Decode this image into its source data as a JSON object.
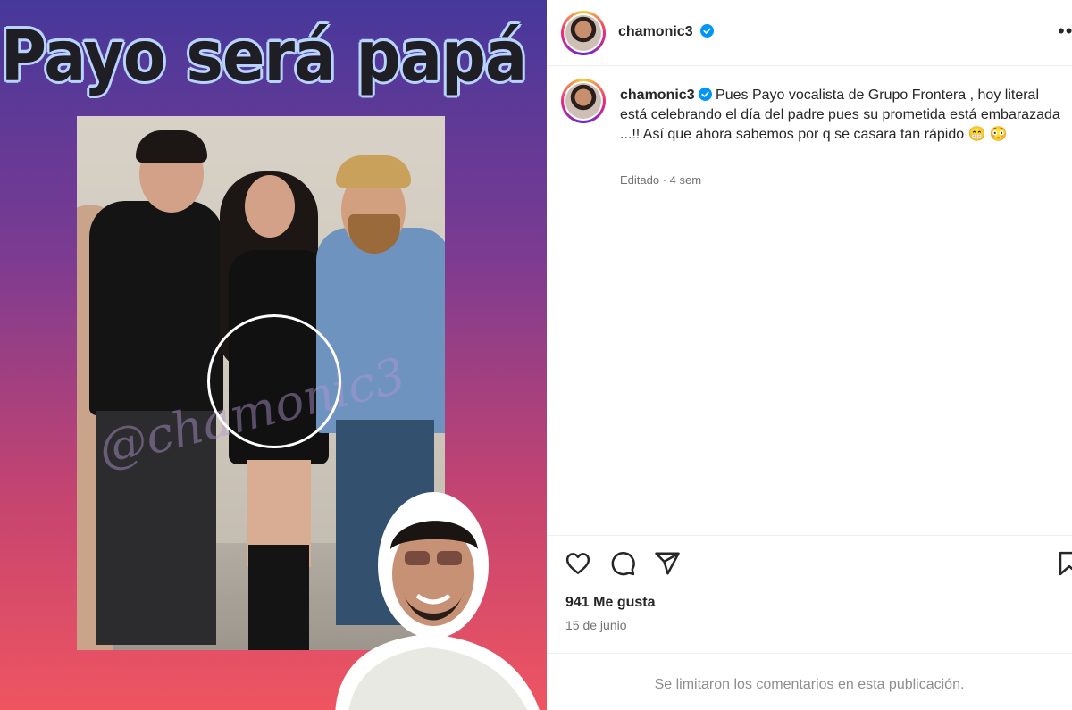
{
  "post_image": {
    "headline": "Payo será papá",
    "watermark": "@chamonic3"
  },
  "header": {
    "username": "chamonic3",
    "verified": true,
    "more_icon": "more-horizontal-icon"
  },
  "caption": {
    "username": "chamonic3",
    "text": "Pues Payo vocalista de Grupo Frontera , hoy literal está celebrando el día del padre pues su prometida está embarazada ...!! Así que ahora sabemos por q se casara tan rápido 😁 😳",
    "meta": "Editado · 4 sem"
  },
  "actions": {
    "icons": [
      "heart-icon",
      "comment-icon",
      "share-icon",
      "bookmark-icon"
    ]
  },
  "stats": {
    "likes": "941 Me gusta",
    "date": "15 de junio"
  },
  "comments": {
    "note": "Se limitaron los comentarios en esta publicación."
  },
  "colors": {
    "verified_blue": "#0095f6",
    "gradient_top": "#46389a",
    "gradient_bottom": "#ef5561"
  }
}
